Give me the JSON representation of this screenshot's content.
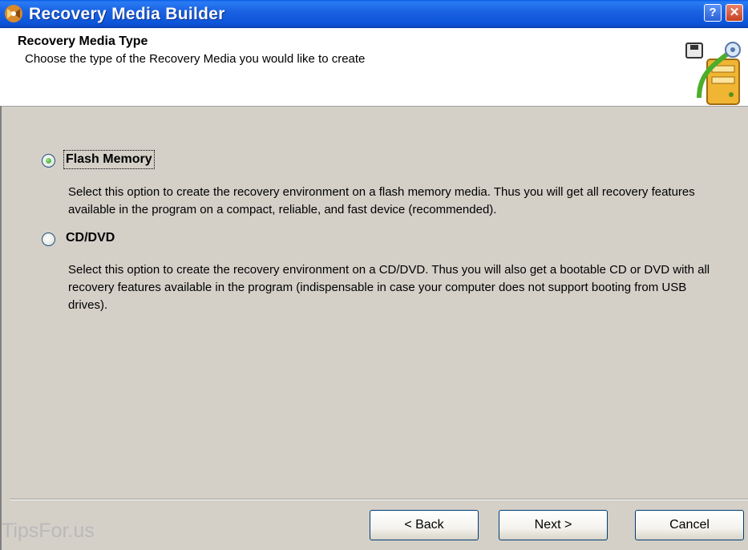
{
  "window": {
    "title": "Recovery Media Builder",
    "icon": "wizard-app-icon",
    "help_label": "?",
    "close_label": "✕"
  },
  "header": {
    "title": "Recovery Media Type",
    "subtitle": "Choose the type of the Recovery Media you would like to create",
    "graphic": "media-drive-graphic"
  },
  "options": [
    {
      "label": "Flash Memory",
      "selected": true,
      "description": "Select this option to create the recovery environment on a flash memory media. Thus you will get all recovery features available in the program on a compact, reliable, and fast device (recommended)."
    },
    {
      "label": "CD/DVD",
      "selected": false,
      "description": "Select this option to create the recovery environment on a CD/DVD. Thus you will also get a bootable CD or DVD with all recovery features available in the program (indispensable in case your computer does not support booting from USB drives)."
    }
  ],
  "buttons": {
    "back": "< Back",
    "next": "Next >",
    "cancel": "Cancel"
  },
  "watermark": "TipsFor.us",
  "colors": {
    "titlebar": "#0d55d9",
    "dialog_bg": "#d4d0c8",
    "radio_check": "#21a121"
  }
}
